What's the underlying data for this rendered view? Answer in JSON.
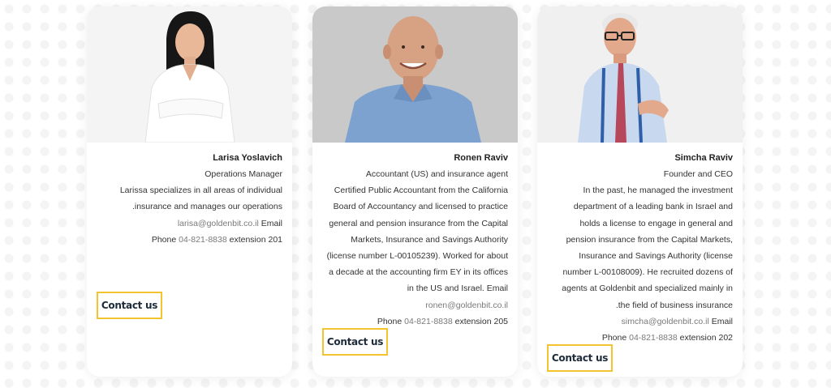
{
  "cards": [
    {
      "name": "Larisa Yoslavich",
      "role": "Operations Manager",
      "desc": [
        "Larissa specializes in all areas of individual",
        ".insurance and manages our operations"
      ],
      "email": "larisa@goldenbit.co.il",
      "email_label": "Email",
      "phone_label": "Phone",
      "phone": "04-821-8838",
      "ext": "extension 201",
      "contact": "Contact us"
    },
    {
      "name": "Ronen Raviv",
      "role": "Accountant (US) and insurance agent",
      "desc": [
        "Certified Public Accountant from the California",
        "Board of Accountancy and licensed to practice",
        "general and pension insurance from the Capital",
        "Markets, Insurance and Savings Authority",
        "(license number L-00105239). Worked for about",
        "a decade at the accounting firm EY in its offices",
        "in the US and Israel. Email"
      ],
      "email": "ronen@goldenbit.co.il",
      "email_label": "",
      "phone_label": "Phone",
      "phone": "04-821-8838",
      "ext": "extension 205",
      "contact": "Contact us"
    },
    {
      "name": "Simcha Raviv",
      "role": "Founder and CEO",
      "desc": [
        "In the past, he managed the investment",
        "department of a leading bank in Israel and",
        "holds a license to engage in general and",
        "pension insurance from the Capital Markets,",
        "Insurance and Savings Authority (license",
        "number L-00108009). He recruited dozens of",
        "agents at Goldenbit and specialized mainly in",
        ".the field of business insurance"
      ],
      "email": "simcha@goldenbit.co.il",
      "email_label": "Email",
      "phone_label": "Phone",
      "phone": "04-821-8838",
      "ext": "extension 202",
      "contact": "Contact us"
    }
  ],
  "colors": {
    "accent_border": "#f4c430",
    "button_text": "#1d2b3a",
    "link_gray": "#7a7a7a"
  }
}
